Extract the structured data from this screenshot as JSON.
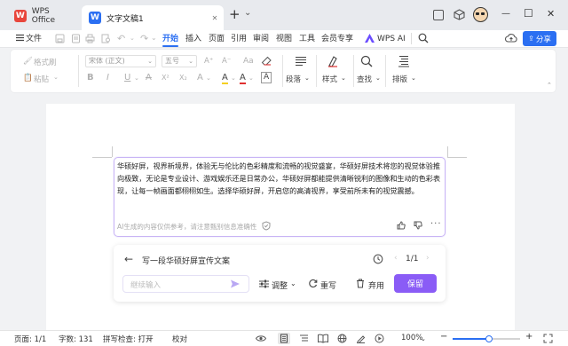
{
  "tabs": {
    "home_label": "WPS Office",
    "doc_label": "文字文稿1",
    "new_tab_symbol": "+",
    "dropdown_symbol": "⌄"
  },
  "window": {
    "minimize": "—",
    "maximize": "☐",
    "close": "✕"
  },
  "menu": {
    "file_label": "文件",
    "items": [
      "开始",
      "插入",
      "页面",
      "引用",
      "审阅",
      "视图",
      "工具",
      "会员专享"
    ],
    "wps_ai_label": "WPS AI",
    "share_label": "分享"
  },
  "ribbon": {
    "format_painter": "格式刷",
    "paste": "粘贴",
    "font_name": "宋体 (正文)",
    "font_size": "五号",
    "paragraph": "段落",
    "styles": "样式",
    "find": "查找",
    "layout": "排版",
    "bold": "B",
    "italic": "I",
    "underline": "U",
    "font_grow": "A⁺",
    "font_shrink": "A⁻",
    "clear_format_glyph": "⌫",
    "highlight": "A",
    "font_color": "A",
    "char_border": "A"
  },
  "ai_result": {
    "text": "华硕好屏，视界新境界，体验无与伦比的色彩精度和流畅的视觉盛宴，华硕好屏技术将您的视觉体验推向极致，无论是专业设计、游戏娱乐还是日常办公，华硕好屏都能提供清晰锐利的图像和生动的色彩表现，让每一帧画面都栩栩如生。选择华硕好屏，开启您的高清视界，享受前所未有的视觉震撼。",
    "disclaimer": "AI生成的内容仅供参考，请注意甄别信息准确性"
  },
  "prompt_panel": {
    "title": "写一段华硕好屏宣传文案",
    "page_counter": "1/1",
    "input_placeholder": "继续输入",
    "adjust_label": "调整",
    "rewrite_label": "重写",
    "discard_label": "弃用",
    "keep_label": "保留"
  },
  "status": {
    "page": "页面: 1/1",
    "words": "字数: 131",
    "spellcheck": "拼写检查: 打开",
    "proofread": "校对",
    "zoom": "100%"
  },
  "colors": {
    "accent_blue": "#2b6ff2",
    "keep_button": "#8a5cf6",
    "wps_logo": "#e8463c",
    "doc_logo": "#2b6ff2"
  }
}
